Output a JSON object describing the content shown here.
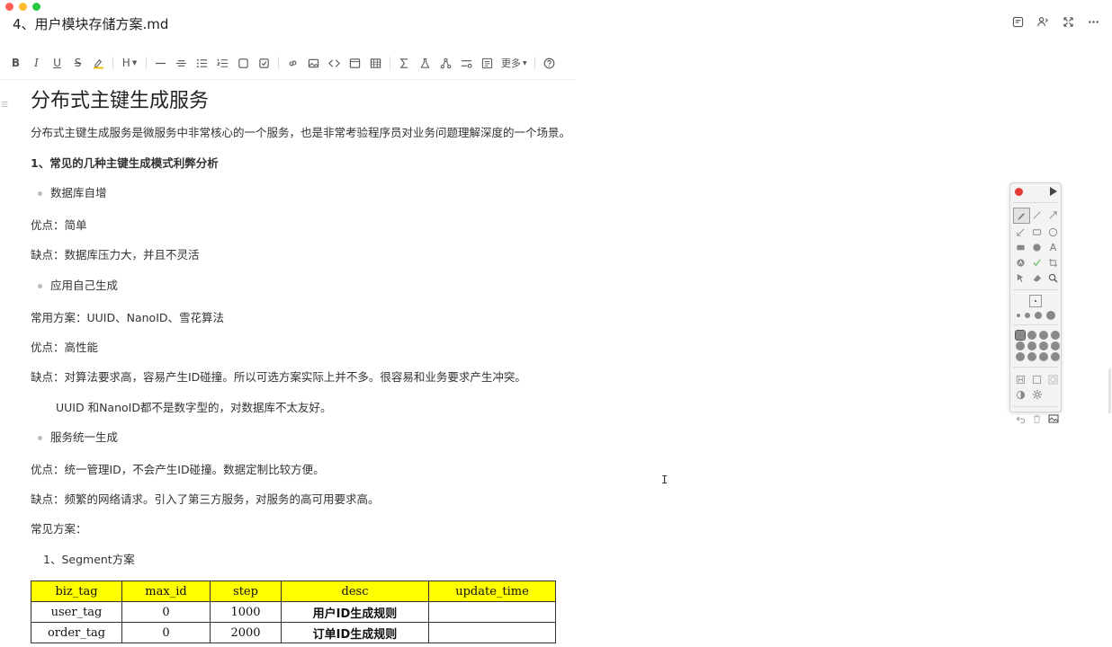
{
  "window": {
    "title": "4、用户模块存储方案.md"
  },
  "toolbar": {
    "items": [
      "B",
      "I",
      "U",
      "S",
      "H",
      "更多"
    ]
  },
  "doc": {
    "heading": "分布式主键生成服务",
    "intro": "分布式主键生成服务是微服务中非常核心的一个服务，也是非常考验程序员对业务问题理解深度的一个场景。",
    "section1": "1、常见的几种主键生成模式利弊分析",
    "b1": "数据库自增",
    "b1_pro": "优点：简单",
    "b1_con": "缺点：数据库压力大，并且不灵活",
    "b2": "应用自己生成",
    "b2_common": "常用方案：UUID、NanoID、雪花算法",
    "b2_pro": "优点：高性能",
    "b2_con": "缺点：对算法要求高，容易产生ID碰撞。所以可选方案实际上并不多。很容易和业务要求产生冲突。",
    "b2_note": "UUID 和NanoID都不是数字型的，对数据库不太友好。",
    "b3": "服务统一生成",
    "b3_pro": "优点：统一管理ID，不会产生ID碰撞。数据定制比较方便。",
    "b3_con": "缺点：频繁的网络请求。引入了第三方服务，对服务的高可用要求高。",
    "common": "常见方案：",
    "segment": "1、Segment方案"
  },
  "table": {
    "headers": [
      "biz_tag",
      "max_id",
      "step",
      "desc",
      "update_time"
    ],
    "rows": [
      [
        "user_tag",
        "0",
        "1000",
        "用户ID生成规则",
        ""
      ],
      [
        "order_tag",
        "0",
        "2000",
        "订单ID生成规则",
        ""
      ]
    ]
  },
  "palette": {
    "text_tool": "A"
  }
}
